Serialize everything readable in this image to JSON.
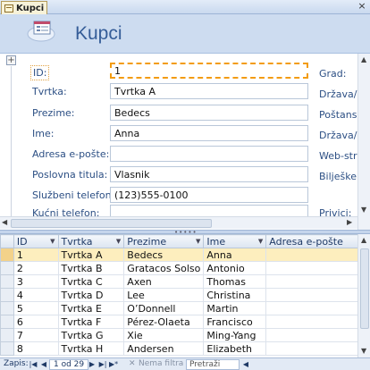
{
  "tab": {
    "label": "Kupci",
    "close": "×"
  },
  "header": {
    "title": "Kupci"
  },
  "detail": {
    "fields": [
      {
        "label": "ID:",
        "value": "1"
      },
      {
        "label": "Tvrtka:",
        "value": "Tvrtka A"
      },
      {
        "label": "Prezime:",
        "value": "Bedecs"
      },
      {
        "label": "Ime:",
        "value": "Anna"
      },
      {
        "label": "Adresa e-pošte:",
        "value": ""
      },
      {
        "label": "Poslovna titula:",
        "value": "Vlasnik"
      },
      {
        "label": "Službeni telefon:",
        "value": "(123)555-0100"
      },
      {
        "label": "Kućni telefon:",
        "value": ""
      }
    ],
    "right_labels": [
      "Grad:",
      "Država/p",
      "Poštansk",
      "Država/re",
      "Web-stra",
      "Bilješke:",
      "",
      "Privici:"
    ]
  },
  "grid": {
    "columns": [
      "ID",
      "Tvrtka",
      "Prezime",
      "Ime",
      "Adresa e-pošte"
    ],
    "rows": [
      [
        "1",
        "Tvrtka A",
        "Bedecs",
        "Anna",
        ""
      ],
      [
        "2",
        "Tvrtka B",
        "Gratacos Solso",
        "Antonio",
        ""
      ],
      [
        "3",
        "Tvrtka C",
        "Axen",
        "Thomas",
        ""
      ],
      [
        "4",
        "Tvrtka D",
        "Lee",
        "Christina",
        ""
      ],
      [
        "5",
        "Tvrtka E",
        "O’Donnell",
        "Martin",
        ""
      ],
      [
        "6",
        "Tvrtka F",
        "Pérez-Olaeta",
        "Francisco",
        ""
      ],
      [
        "7",
        "Tvrtka G",
        "Xie",
        "Ming-Yang",
        ""
      ],
      [
        "8",
        "Tvrtka H",
        "Andersen",
        "Elizabeth",
        ""
      ]
    ]
  },
  "navbar": {
    "record_label": "Zapis:",
    "record_value": "1 od 29",
    "filter_label": "Nema filtra",
    "search_placeholder": "Pretraži"
  }
}
